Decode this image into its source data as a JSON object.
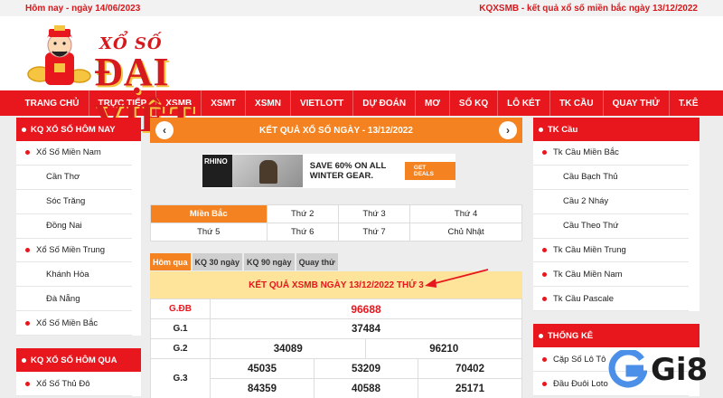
{
  "topbar": {
    "left": "Hôm nay - ngày 14/06/2023",
    "right": "KQXSMB - kết quả xổ số miền bắc ngày 13/12/2022"
  },
  "logo": {
    "small": "XỔ SỐ",
    "big": "ĐẠI VIỆT"
  },
  "nav": [
    "TRANG CHỦ",
    "TRỰC TIẾP",
    "XSMB",
    "XSMT",
    "XSMN",
    "VIETLOTT",
    "DỰ ĐOÁN",
    "MƠ",
    "SỐ KQ",
    "LÔ KÉT",
    "TK CẦU",
    "QUAY THỬ",
    "T.KÊ"
  ],
  "left_box1": {
    "title": "KQ XỔ SỐ HÔM NAY",
    "items": [
      {
        "label": "Xổ Số Miền Nam",
        "type": "parent"
      },
      {
        "label": "Cần Thơ",
        "type": "child"
      },
      {
        "label": "Sóc Trăng",
        "type": "child"
      },
      {
        "label": "Đồng Nai",
        "type": "child"
      },
      {
        "label": "Xổ Số Miền Trung",
        "type": "parent"
      },
      {
        "label": "Khánh Hòa",
        "type": "child"
      },
      {
        "label": "Đà Nẵng",
        "type": "child"
      },
      {
        "label": "Xổ Số Miền Bắc",
        "type": "parent"
      }
    ]
  },
  "left_box2": {
    "title": "KQ XỔ SỐ HÔM QUA",
    "items": [
      {
        "label": "Xổ Số Thủ Đô",
        "type": "parent"
      }
    ]
  },
  "right_box1": {
    "title": "TK Cầu",
    "items": [
      {
        "label": "Tk Cầu Miền Bắc",
        "type": "parent"
      },
      {
        "label": "Cầu Bạch Thủ",
        "type": "child"
      },
      {
        "label": "Cầu 2 Nháy",
        "type": "child"
      },
      {
        "label": "Cầu Theo Thứ",
        "type": "child"
      },
      {
        "label": "Tk Cầu Miền Trung",
        "type": "parent"
      },
      {
        "label": "Tk Cầu Miền Nam",
        "type": "parent"
      },
      {
        "label": "Tk Cầu Pascale",
        "type": "parent"
      }
    ]
  },
  "right_box2": {
    "title": "THỐNG KÊ",
    "items": [
      {
        "label": "Cặp Số Lô Tô",
        "type": "parent"
      },
      {
        "label": "Đầu Đuôi Loto",
        "type": "parent"
      }
    ]
  },
  "center": {
    "orange_title": "KẾT QUẢ XỔ SỐ NGÀY - 13/12/2022",
    "prev": "‹",
    "next": "›",
    "ad": {
      "brand": "RHINO",
      "text": "SAVE 60% ON ALL WINTER GEAR.",
      "button": "GET DEALS"
    },
    "days": [
      [
        "Miền Bắc",
        "Thứ 2",
        "Thứ 3",
        "Thứ 4"
      ],
      [
        "Thứ 5",
        "Thứ 6",
        "Thứ 7",
        "Chủ Nhật"
      ]
    ],
    "tabs": [
      "Hôm qua",
      "KQ 30 ngày",
      "KQ 90 ngày",
      "Quay thử"
    ],
    "result_title": "KẾT QUẢ XSMB NGÀY 13/12/2022 THỨ 3",
    "results": {
      "gdb_label": "G.ĐB",
      "gdb": "96688",
      "g1_label": "G.1",
      "g1": "37484",
      "g2_label": "G.2",
      "g2": [
        "34089",
        "96210"
      ],
      "g3_label": "G.3",
      "g3": [
        "45035",
        "53209",
        "70402",
        "84359",
        "40588",
        "25171"
      ]
    }
  },
  "watermark": "Gi8",
  "colors": {
    "red": "#e8161d",
    "orange": "#f58220",
    "yellow": "#fde49a"
  }
}
